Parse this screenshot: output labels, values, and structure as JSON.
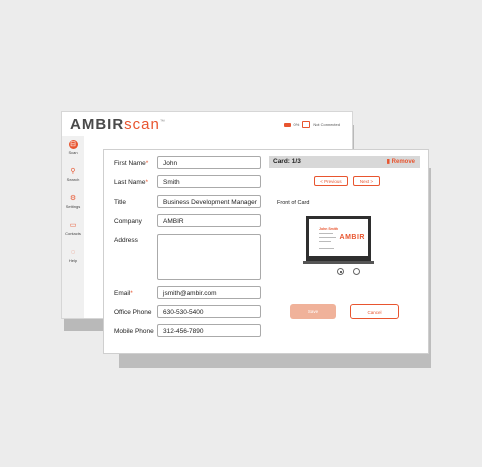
{
  "app": {
    "logo_bold": "AMBIR",
    "logo_light": "scan",
    "logo_mark": "™",
    "status_battery": "0%",
    "status_connection": "Not Connected",
    "nav": [
      {
        "label": "Scan",
        "icon": "scan-icon"
      },
      {
        "label": "Search",
        "icon": "search-icon"
      },
      {
        "label": "Settings",
        "icon": "gear-icon"
      },
      {
        "label": "Contacts",
        "icon": "contacts-icon"
      },
      {
        "label": "Help",
        "icon": "help-icon"
      }
    ]
  },
  "form": {
    "first_name_label": "First Name",
    "first_name": "John",
    "last_name_label": "Last Name",
    "last_name": "Smith",
    "title_label": "Title",
    "title": "Business Development Manager",
    "company_label": "Company",
    "company": "AMBIR",
    "address_label": "Address",
    "address": "",
    "email_label": "Email",
    "email": "jsmith@ambir.com",
    "office_phone_label": "Office Phone",
    "office_phone": "630-530-5400",
    "mobile_phone_label": "Mobile Phone",
    "mobile_phone": "312-456-7890",
    "required_mark": "*"
  },
  "card": {
    "counter": "Card: 1/3",
    "remove_label": "Remove",
    "previous_label": "< Previous",
    "next_label": "Next >",
    "front_label": "Front of Card",
    "preview_name": "John Smith",
    "preview_brand": "AMBIR",
    "selected_side": 1
  },
  "actions": {
    "save_label": "Save",
    "cancel_label": "Cancel"
  },
  "colors": {
    "accent": "#e8552f",
    "save_disabled": "#f0b29a"
  }
}
